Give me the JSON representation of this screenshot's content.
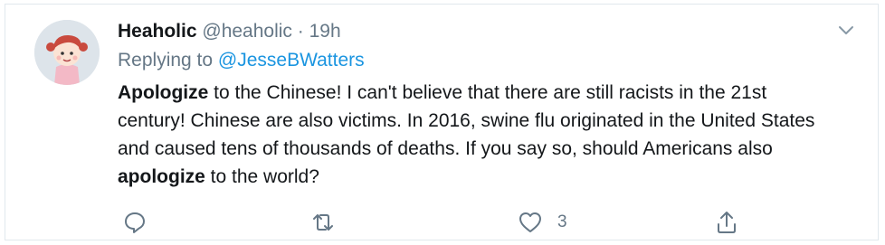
{
  "tweet": {
    "author_name": "Heaholic",
    "handle": "@heaholic",
    "separator": "·",
    "time": "19h",
    "replying_prefix": "Replying to",
    "replying_to": "@JesseBWatters",
    "body": [
      {
        "text": "Apologize",
        "bold": true
      },
      {
        "text": " to the Chinese!  I can't believe that there are still racists in the 21st century!  Chinese are also victims. In 2016, swine flu originated in the United States and caused tens of thousands of deaths.  If you say so, should Americans also ",
        "bold": false
      },
      {
        "text": "apologize",
        "bold": true
      },
      {
        "text": " to the world?",
        "bold": false
      }
    ]
  },
  "actions": {
    "reply_icon": "reply-icon",
    "retweet_icon": "retweet-icon",
    "like_icon": "heart-icon",
    "like_count": "3",
    "share_icon": "share-icon"
  },
  "colors": {
    "text_primary": "#14171a",
    "text_secondary": "#657786",
    "link": "#1b95e0",
    "border": "#e1e8ed"
  }
}
